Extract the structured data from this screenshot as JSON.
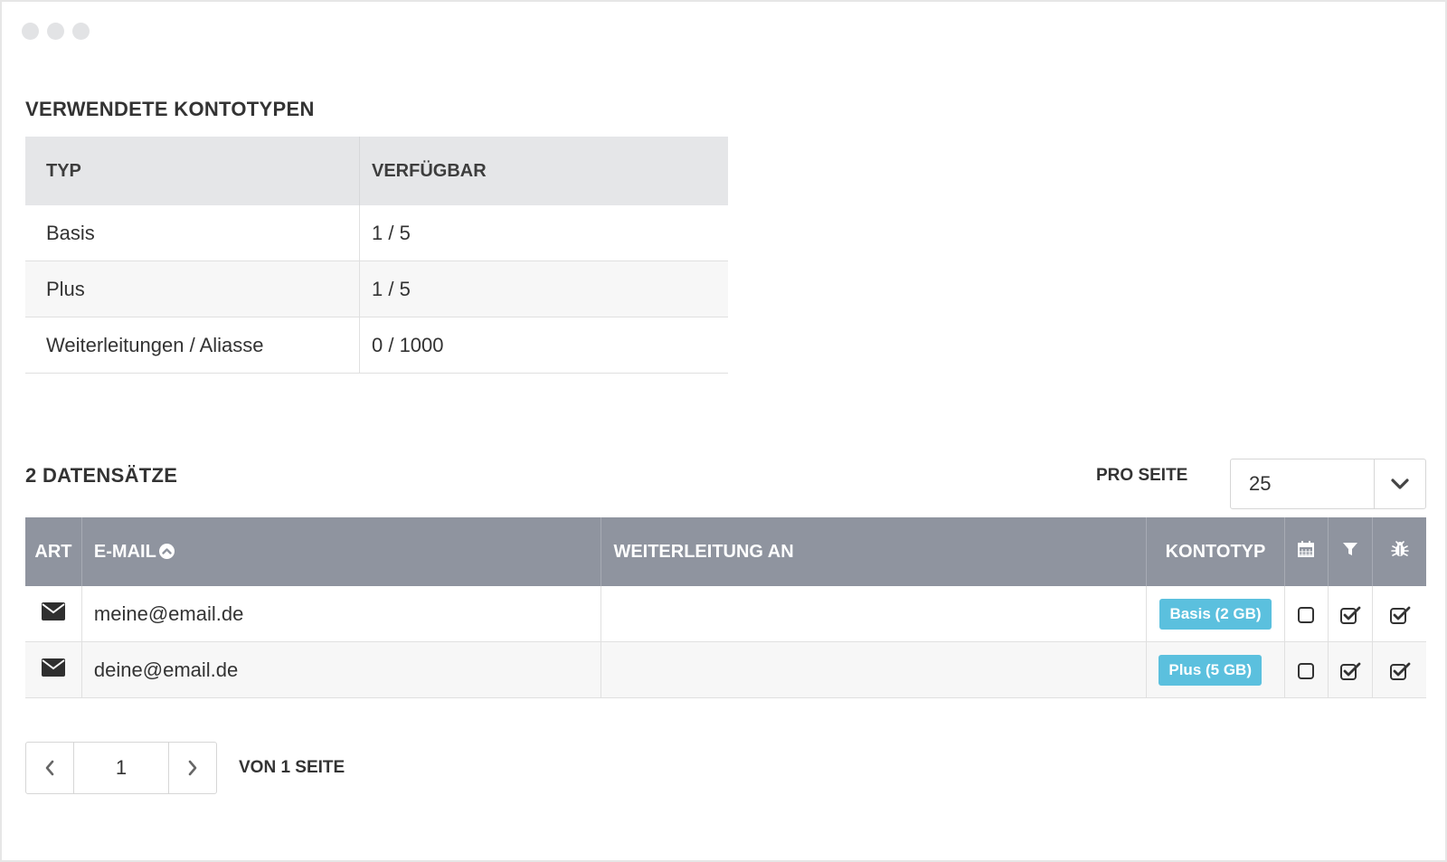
{
  "types_section": {
    "title": "VERWENDETE KONTOTYPEN",
    "headers": {
      "type": "TYP",
      "available": "VERFÜGBAR"
    },
    "rows": [
      {
        "type": "Basis",
        "available": "1 / 5"
      },
      {
        "type": "Plus",
        "available": "1 / 5"
      },
      {
        "type": "Weiterleitungen / Aliasse",
        "available": "0 / 1000"
      }
    ]
  },
  "records_section": {
    "title": "2 DATENSÄTZE",
    "per_page_label": "PRO SEITE",
    "per_page_value": "25",
    "headers": {
      "art": "ART",
      "email": "E-MAIL",
      "forward": "WEITERLEITUNG AN",
      "account_type": "KONTOTYP"
    },
    "rows": [
      {
        "email": "meine@email.de",
        "forward": "",
        "account_type": "Basis (2 GB)",
        "calendar": false,
        "filter": true,
        "bug": true
      },
      {
        "email": "deine@email.de",
        "forward": "",
        "account_type": "Plus (5 GB)",
        "calendar": false,
        "filter": true,
        "bug": true
      }
    ]
  },
  "pagination": {
    "current_page": "1",
    "of_pages": "VON 1 SEITE"
  },
  "colors": {
    "header_gray": "#8f949f",
    "badge_blue": "#5bc0de",
    "light_header": "#e5e6e8"
  }
}
